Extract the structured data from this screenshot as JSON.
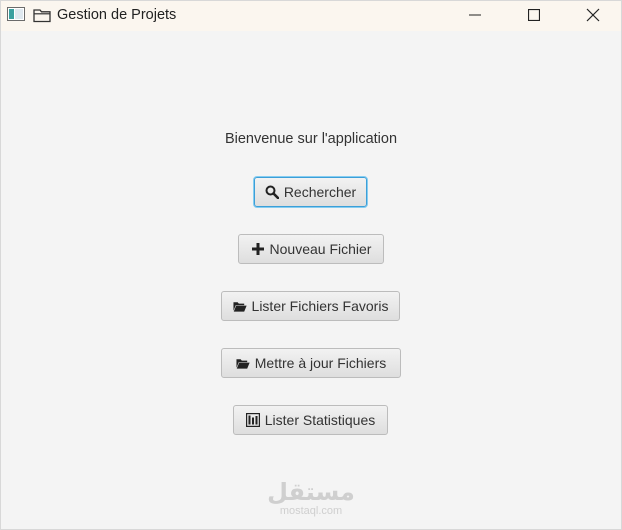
{
  "window": {
    "title": "Gestion de Projets"
  },
  "main": {
    "welcome": "Bienvenue sur l'application",
    "buttons": [
      {
        "label": "Rechercher",
        "icon": "search-icon"
      },
      {
        "label": "Nouveau Fichier",
        "icon": "plus-icon"
      },
      {
        "label": "Lister Fichiers Favoris",
        "icon": "folder-open-icon"
      },
      {
        "label": "Mettre à jour Fichiers",
        "icon": "folder-open-icon"
      },
      {
        "label": "Lister Statistiques",
        "icon": "bar-chart-icon"
      }
    ]
  },
  "watermark": {
    "logo": "مستقل",
    "url": "mostaql.com"
  },
  "colors": {
    "titlebar": "#fbf6ef",
    "background": "#f4f4f4",
    "focus": "#3c9fd8"
  }
}
